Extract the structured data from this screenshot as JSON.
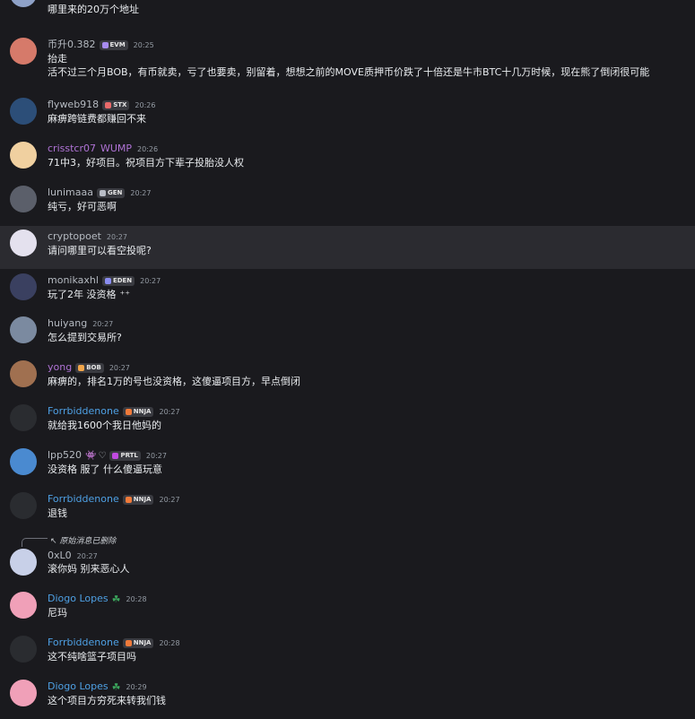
{
  "messages": [
    {
      "name": "",
      "ts": "",
      "text": "哪里来的20万个地址",
      "nameColor": "#b5bac1"
    },
    {
      "name": "币升0.382",
      "tag": "EVM",
      "ts": "20:25",
      "text": "抬走",
      "text2": "活不过三个月BOB，有币就卖，亏了也要卖，别留着，想想之前的MOVE质押币价跌了十倍还是牛市BTC十几万时候，现在熊了倒闭很可能",
      "nameColor": "#b5bac1"
    },
    {
      "name": "flyweb918",
      "tag": "STX",
      "ts": "20:26",
      "text": "麻痹跨链费都赚回不来",
      "nameColor": "#b5bac1"
    },
    {
      "name": "crisstcr07",
      "tag2": "WUMP",
      "ts": "20:26",
      "text": "71中3，好项目。祝项目方下辈子投胎没人权",
      "nameColor": "#b073d6"
    },
    {
      "name": "lunimaaa",
      "tag": "GEN",
      "ts": "20:27",
      "text": "纯亏，好可恶啊",
      "nameColor": "#b5bac1"
    },
    {
      "name": "cryptopoet",
      "ts": "20:27",
      "text": "请问哪里可以看空投呢?",
      "nameColor": "#b5bac1"
    },
    {
      "name": "monikaxhl",
      "tag": "EDEN",
      "ts": "20:27",
      "text": "玩了2年 没资格",
      "nameColor": "#b5bac1"
    },
    {
      "name": "huiyang",
      "ts": "20:27",
      "text": "怎么提到交易所?",
      "nameColor": "#b5bac1"
    },
    {
      "name": "yong",
      "tag": "BOB",
      "ts": "20:27",
      "text": "麻痹的，排名1万的号也没资格，这傻逼项目方，早点倒闭",
      "nameColor": "#b073d6"
    },
    {
      "name": "Forrbiddenone",
      "tag": "NNJA",
      "ts": "20:27",
      "text": "就给我1600个我日他妈的",
      "nameColor": "#4ea0e4"
    },
    {
      "name": "lpp520",
      "tag": "PRTL",
      "ts": "20:27",
      "text": "没资格 服了 什么傻逼玩意",
      "nameColor": "#b5bac1"
    },
    {
      "name": "Forrbiddenone",
      "tag": "NNJA",
      "ts": "20:27",
      "text": "退钱",
      "nameColor": "#4ea0e4"
    },
    {
      "name": "0xL0",
      "ts": "20:27",
      "text": "滚你妈 别来恶心人",
      "nameColor": "#b5bac1",
      "reply": "原始消息已删除"
    },
    {
      "name": "Diogo Lopes",
      "ts": "20:28",
      "text": "尼玛",
      "nameColor": "#4ea0e4"
    },
    {
      "name": "Forrbiddenone",
      "tag": "NNJA",
      "ts": "20:28",
      "text": "这不纯啥篮子项目吗",
      "nameColor": "#4ea0e4"
    },
    {
      "name": "Diogo Lopes",
      "ts": "20:29",
      "text": "这个项目方穷死来转我们钱",
      "nameColor": "#4ea0e4"
    }
  ]
}
